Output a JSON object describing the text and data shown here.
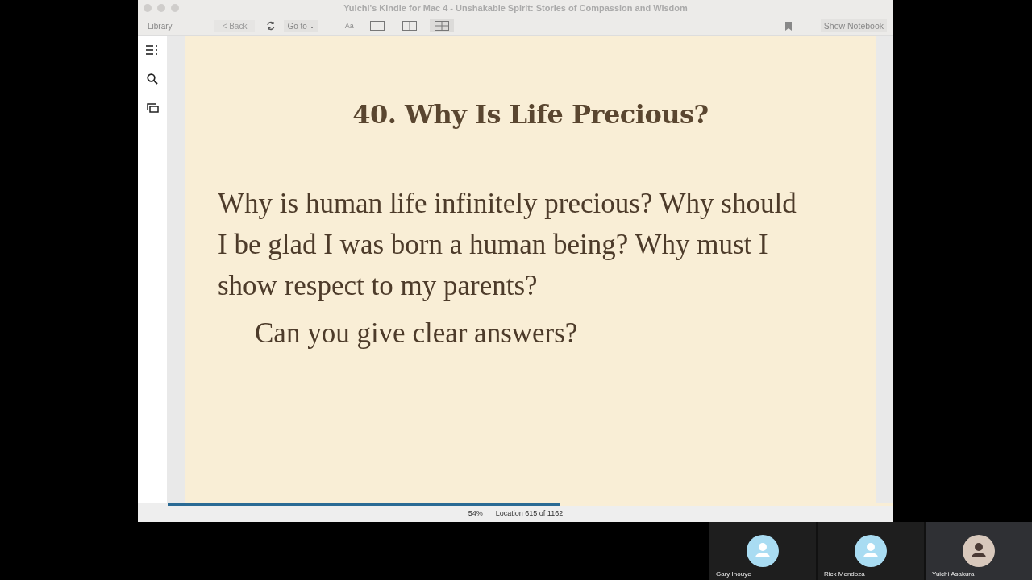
{
  "window": {
    "title": "Yuichi's Kindle for Mac 4 - Unshakable Spirit: Stories of Compassion and Wisdom"
  },
  "toolbar": {
    "library": "Library",
    "back": "< Back",
    "goto": "Go to",
    "font": "Aa",
    "view_modes": [
      {
        "kind": "single",
        "selected": false
      },
      {
        "kind": "double",
        "selected": false
      },
      {
        "kind": "grid",
        "selected": true
      }
    ],
    "notebook": "Show Notebook"
  },
  "book": {
    "heading": "40. Why Is Life Precious?",
    "paragraphs": [
      {
        "text": "Why is human life infinitely precious? Why should I be glad I was born a human being? Why must I show respect to my parents?",
        "indented": false
      },
      {
        "text": "Can you give clear answers?",
        "indented": true
      }
    ]
  },
  "status_bar": {
    "percent": "54%",
    "location": "Location 615 of 1162",
    "progress": {
      "level": 0.54
    }
  },
  "participants": [
    {
      "name": "Gary Inouye",
      "active": false
    },
    {
      "name": "Rick Mendoza",
      "active": false
    },
    {
      "name": "Yuichi Asakura",
      "active": true
    }
  ]
}
